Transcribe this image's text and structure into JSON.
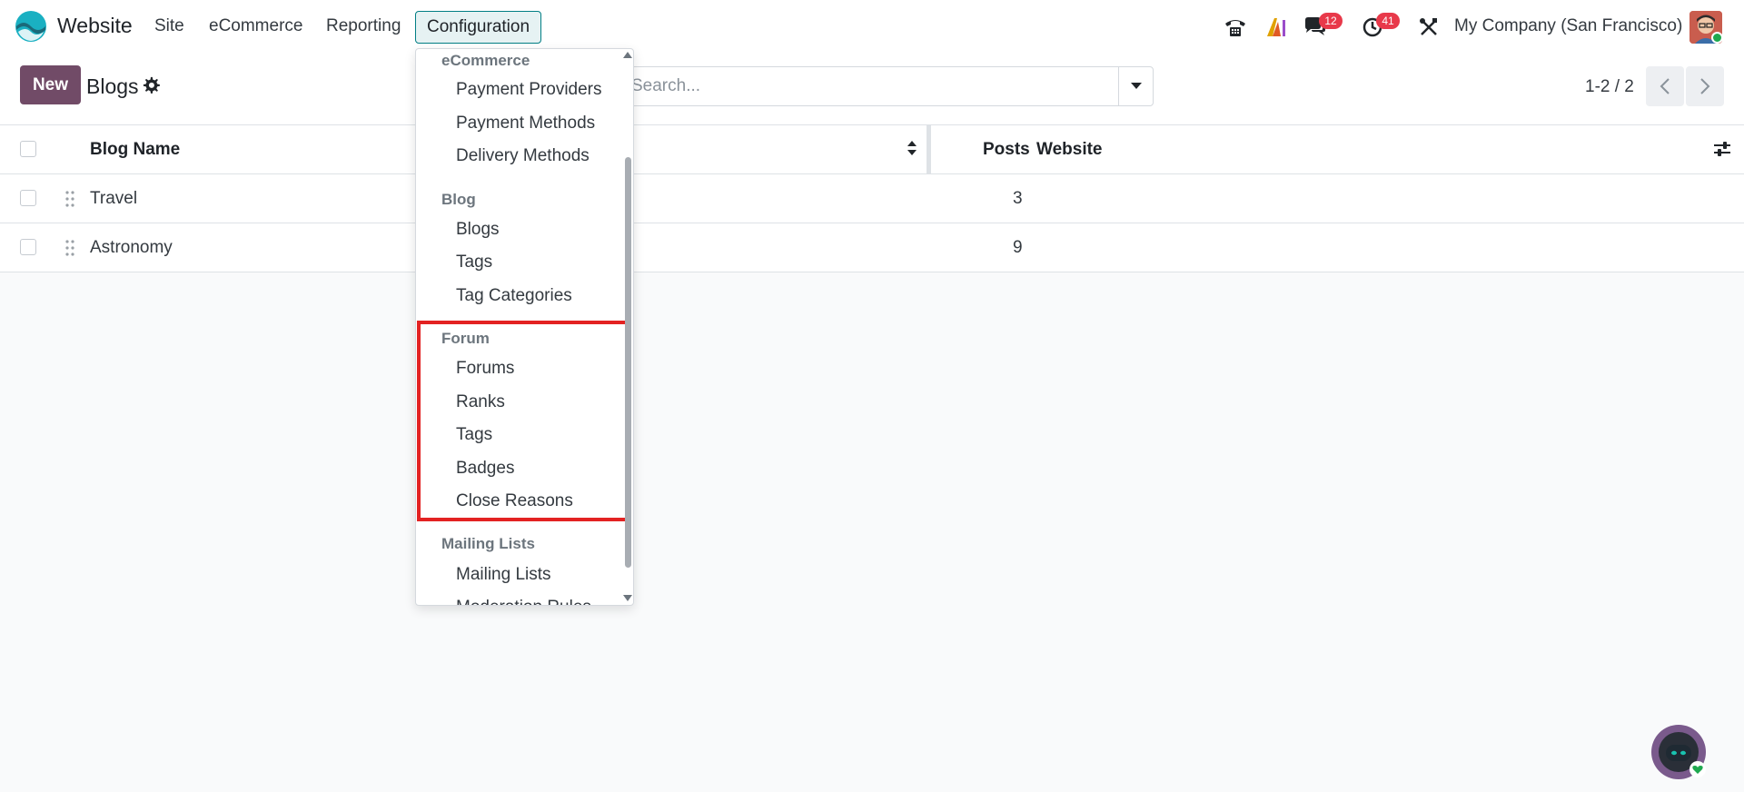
{
  "navbar": {
    "app_name": "Website",
    "menu": [
      "Site",
      "eCommerce",
      "Reporting",
      "Configuration"
    ],
    "badges": {
      "messages": "12",
      "activities": "41"
    },
    "company": "My Company (San Francisco)",
    "colors": {
      "accent": "#714b67",
      "active_menu_border": "#017e84",
      "badge": "#e8394a"
    }
  },
  "control_panel": {
    "new_label": "New",
    "breadcrumb": "Blogs",
    "search_placeholder": "Search...",
    "pager": "1-2 / 2"
  },
  "list": {
    "columns": [
      "Blog Name",
      "Posts",
      "Website"
    ],
    "rows": [
      {
        "name": "Travel",
        "posts": "3",
        "website": ""
      },
      {
        "name": "Astronomy",
        "posts": "9",
        "website": ""
      }
    ]
  },
  "dropdown": {
    "sections": [
      {
        "header": "eCommerce",
        "items": [
          "Payment Providers",
          "Payment Methods",
          "Delivery Methods"
        ]
      },
      {
        "header": "Blog",
        "items": [
          "Blogs",
          "Tags",
          "Tag Categories"
        ]
      },
      {
        "header": "Forum",
        "items": [
          "Forums",
          "Ranks",
          "Tags",
          "Badges",
          "Close Reasons"
        ]
      },
      {
        "header": "Mailing Lists",
        "items": [
          "Mailing Lists",
          "Moderation Rules"
        ]
      }
    ]
  }
}
